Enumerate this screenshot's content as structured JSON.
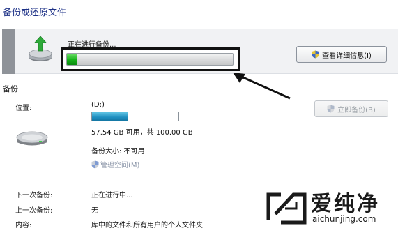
{
  "window": {
    "title": "备份或还原文件"
  },
  "status": {
    "text": "正在进行备份...",
    "progress": 0.06,
    "details_button": "查看详细信息(I)"
  },
  "backup": {
    "section_title": "备份",
    "location_label": "位置:",
    "drive": "(D:)",
    "disk_used_fraction": 0.42,
    "space_text": "57.54 GB 可用，共 100.00 GB",
    "size_text": "备份大小: 不可用",
    "manage_space": "管理空间(M)",
    "backup_now": "立即备份(B)",
    "rows": [
      {
        "label": "下一次备份:",
        "value": "正在进行中..."
      },
      {
        "label": "上一次备份:",
        "value": "无"
      },
      {
        "label": "内容:",
        "value": "库中的文件和所有用户的个人文件夹"
      }
    ]
  },
  "watermark": {
    "name": "爱纯净",
    "url": "aichunjing.com"
  },
  "colors": {
    "title": "#1e3287",
    "progress_green": "#17b21a",
    "disk_blue": "#1f8fc0",
    "link_gray": "#8893a6"
  }
}
